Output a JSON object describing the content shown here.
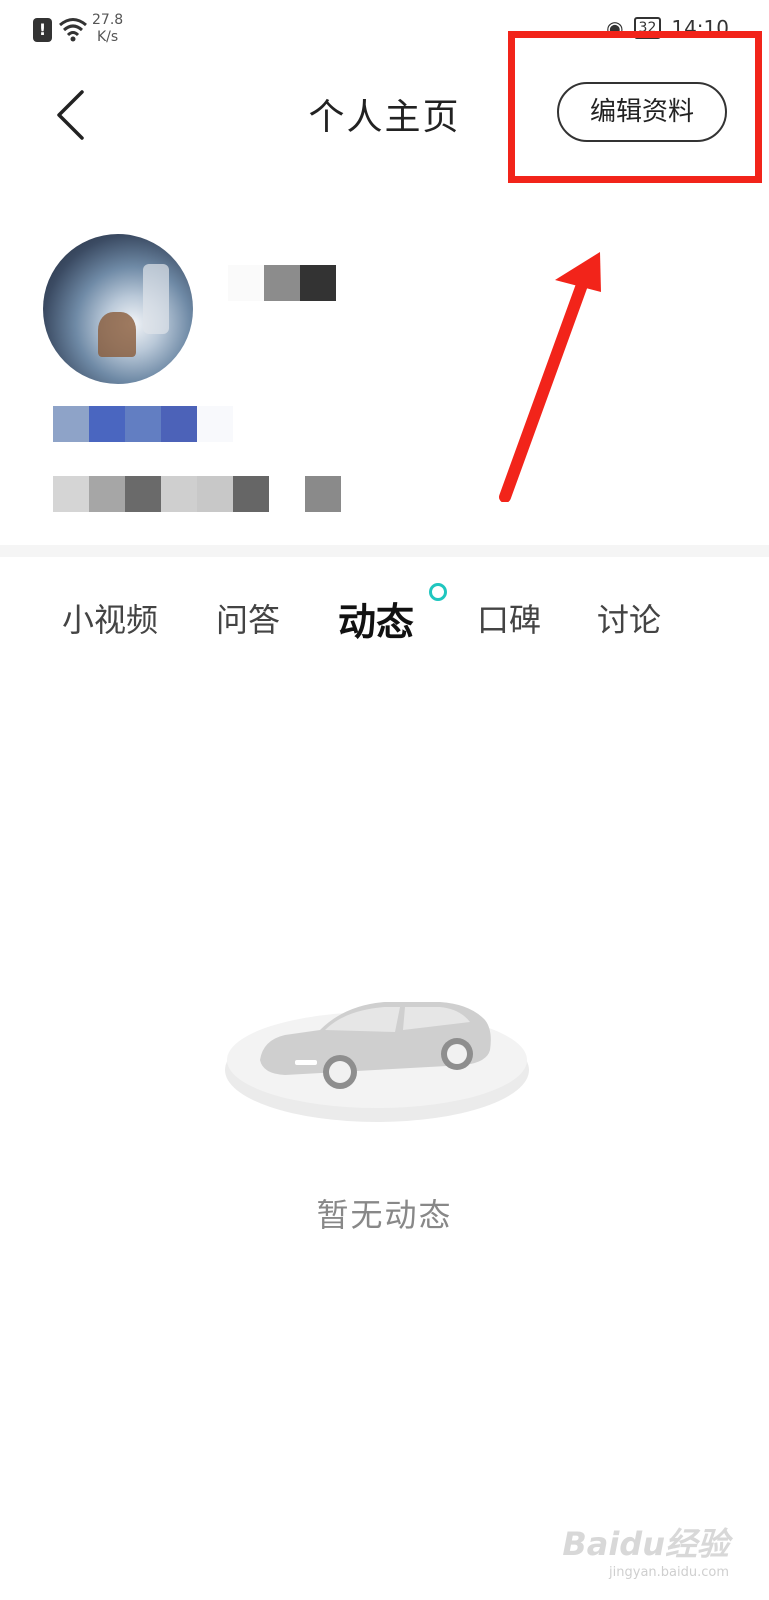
{
  "status_bar": {
    "net_speed_value": "27.8",
    "net_speed_unit": "K/s",
    "battery": "32",
    "time": "14:10"
  },
  "header": {
    "title": "个人主页",
    "edit_button": "编辑资料"
  },
  "tabs": [
    {
      "label": "小视频",
      "active": false
    },
    {
      "label": "问答",
      "active": false
    },
    {
      "label": "动态",
      "active": true
    },
    {
      "label": "口碑",
      "active": false
    },
    {
      "label": "讨论",
      "active": false
    }
  ],
  "empty_state": {
    "message": "暂无动态"
  },
  "watermark": {
    "brand": "Baidu经验",
    "url": "jingyan.baidu.com"
  },
  "colors": {
    "annotation_red": "#f2241a",
    "tab_dot": "#1fc6bf"
  },
  "icons": [
    "back-arrow-icon",
    "wifi-icon",
    "alert-icon",
    "eye-icon"
  ]
}
